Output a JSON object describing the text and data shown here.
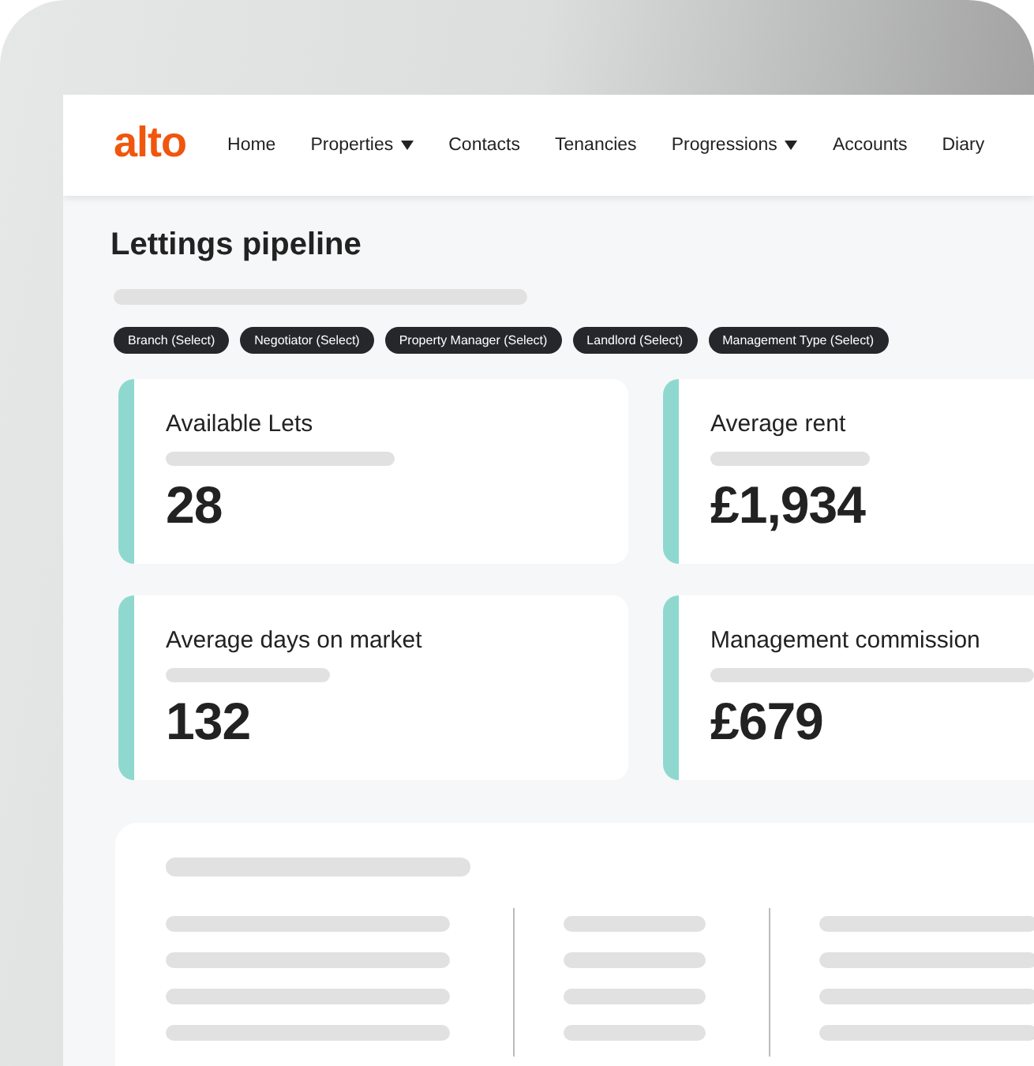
{
  "logo": "alto",
  "nav": [
    {
      "label": "Home",
      "dropdown": false
    },
    {
      "label": "Properties",
      "dropdown": true
    },
    {
      "label": "Contacts",
      "dropdown": false
    },
    {
      "label": "Tenancies",
      "dropdown": false
    },
    {
      "label": "Progressions",
      "dropdown": true
    },
    {
      "label": "Accounts",
      "dropdown": false
    },
    {
      "label": "Diary",
      "dropdown": false
    }
  ],
  "page_title": "Lettings pipeline",
  "filters": [
    "Branch (Select)",
    "Negotiator (Select)",
    "Property Manager (Select)",
    "Landlord (Select)",
    "Management Type (Select)"
  ],
  "stats": [
    {
      "label": "Available Lets",
      "value": "28"
    },
    {
      "label": "Average rent",
      "value": "£1,934"
    },
    {
      "label": "Average days on market",
      "value": "132"
    },
    {
      "label": "Management commission",
      "value": "£679"
    }
  ]
}
